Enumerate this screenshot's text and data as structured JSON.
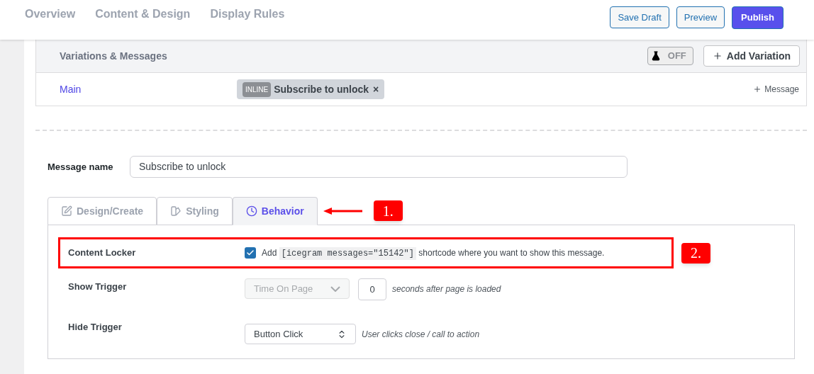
{
  "nav_tabs": [
    {
      "label": "Overview",
      "selected": false
    },
    {
      "label": "Content & Design",
      "selected": false
    },
    {
      "label": "Display Rules",
      "selected": false
    }
  ],
  "actions": [
    {
      "label": "Save Draft",
      "kind": "outline"
    },
    {
      "label": "Preview",
      "kind": "outline"
    },
    {
      "label": "Publish",
      "kind": "primary"
    }
  ],
  "variations": {
    "title": "Variations & Messages",
    "ab_test": {
      "label": "OFF",
      "on": false
    },
    "add_variation": "Add Variation",
    "rows": [
      {
        "name": "Main",
        "message": {
          "badge": "INLINE",
          "label": "Subscribe to unlock",
          "remove": "×"
        },
        "add_message": "Message"
      }
    ]
  },
  "message_name": {
    "label": "Message name",
    "value": "Subscribe to unlock"
  },
  "tabs": [
    {
      "label": "Design/Create",
      "selected": false
    },
    {
      "label": "Styling",
      "selected": false
    },
    {
      "label": "Behavior",
      "selected": true
    }
  ],
  "annotations": [
    {
      "label": "1."
    },
    {
      "label": "2."
    }
  ],
  "settings": [
    {
      "kind": "checkbox",
      "label": "Content Locker",
      "checked": true,
      "text_before": "Add",
      "code": "[icegram messages=\"15142\"]",
      "text_after": "shortcode where you want to show this message."
    },
    {
      "kind": "select",
      "label": "Show Trigger",
      "value": "Time On Page",
      "disabled": true,
      "number": "0",
      "hint": "seconds after page is loaded"
    },
    {
      "kind": "select",
      "label": "Hide Trigger",
      "value": "Button Click",
      "disabled": false,
      "hint": "User clicks close / call to action"
    }
  ]
}
